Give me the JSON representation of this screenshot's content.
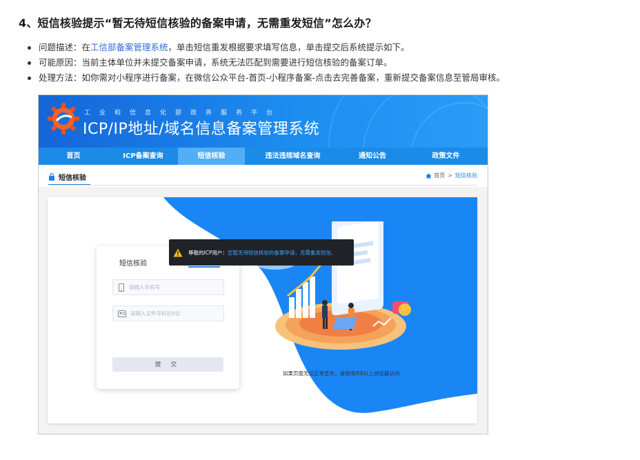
{
  "heading": "4、短信核验提示“暂无待短信核验的备案申请，无需重发短信”怎么办？",
  "bullets": [
    {
      "label": "问题描述：",
      "before": "在",
      "link": "工信部备案管理系统",
      "after": "，单击短信重发根据要求填写信息，单击提交后系统提示如下。"
    },
    {
      "label": "可能原因：",
      "text": "当前主体单位并未提交备案申请，系统无法匹配到需要进行短信核验的备案订单。"
    },
    {
      "label": "处理方法：",
      "text": "如你需对小程序进行备案，在微信公众平台-首页-小程序备案-点击去完善备案，重新提交备案信息至管局审核。"
    }
  ],
  "screenshot": {
    "banner_small": "工业和信息化部政务服务平台",
    "banner_title": "ICP/IP地址/域名信息备案管理系统",
    "nav": [
      {
        "label": "首页",
        "active": false
      },
      {
        "label": "ICP备案查询",
        "active": false
      },
      {
        "label": "短信核验",
        "active": true
      },
      {
        "label": "违法违规域名查询",
        "active": false
      },
      {
        "label": "通知公告",
        "active": false
      },
      {
        "label": "政策文件",
        "active": false
      }
    ],
    "tab_label": "短信核验",
    "breadcrumb": {
      "home": "首页",
      "sep": ">",
      "current": "短信核验"
    },
    "login": {
      "tab": "短信核验",
      "phone_placeholder": "请输入手机号",
      "id_placeholder": "请输入证件号码后6位",
      "submit": "提 交"
    },
    "toast": {
      "prefix": "尊敬的ICP用户：",
      "message": "您暂无待短信核验的备案申请，无需重发短信。"
    },
    "footnote": "如果页面无法正常显示，请使用IE8以上浏览器访问",
    "colors": {
      "banner": "#1c8cf0",
      "nav": "#1c8be8",
      "nav_active": "#52aef6",
      "blob": "#1a86f5",
      "link": "#2f6bd7",
      "toast_highlight": "#3fa2ff"
    }
  }
}
